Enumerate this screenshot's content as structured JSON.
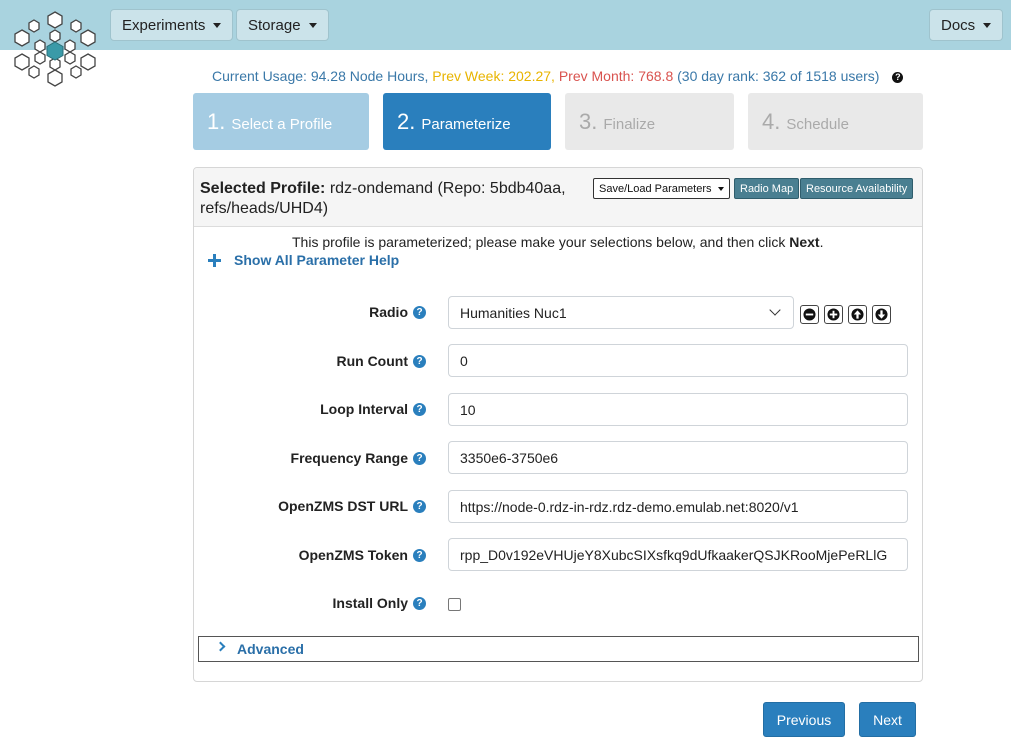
{
  "navbar": {
    "experiments_label": "Experiments",
    "storage_label": "Storage",
    "docs_label": "Docs",
    "logo_icon": "snowflake-logo-icon"
  },
  "usage": {
    "current": "Current Usage: 94.28 Node Hours,",
    "prev_week": "Prev Week: 202.27,",
    "prev_month": "Prev Month: 768.8",
    "rank": "(30 day rank: 362 of 1518 users)",
    "help": "?"
  },
  "steps": [
    {
      "num": "1.",
      "label": "Select a Profile"
    },
    {
      "num": "2.",
      "label": "Parameterize"
    },
    {
      "num": "3.",
      "label": "Finalize"
    },
    {
      "num": "4.",
      "label": "Schedule"
    }
  ],
  "panel": {
    "title_bold": "Selected Profile:",
    "title_rest": "rdz-ondemand (Repo: 5bdb40aa, refs/heads/UHD4)",
    "save_load_label": "Save/Load Parameters",
    "radio_map_label": "Radio Map",
    "resource_label": "Resource Availability",
    "intro_text": "This profile is parameterized; please make your selections below, and then click ",
    "intro_bold": "Next",
    "intro_end": ".",
    "show_help_label": "Show All Parameter Help",
    "advanced_label": "Advanced"
  },
  "form": {
    "radio_label": "Radio",
    "radio_value": "Humanities Nuc1",
    "run_count_label": "Run Count",
    "run_count_value": "0",
    "loop_interval_label": "Loop Interval",
    "loop_interval_value": "10",
    "freq_label": "Frequency Range",
    "freq_value": "3350e6-3750e6",
    "dst_url_label": "OpenZMS DST URL",
    "dst_url_value": "https://node-0.rdz-in-rdz.rdz-demo.emulab.net:8020/v1",
    "token_label": "OpenZMS Token",
    "token_value": "rpp_D0v192eVHUjeY8XubcSIXsfkq9dUfkaakerQSJKRooMjePeRLlG",
    "install_only_label": "Install Only",
    "install_only_checked": false,
    "help_glyph": "?"
  },
  "footer": {
    "previous_label": "Previous",
    "next_label": "Next"
  },
  "colors": {
    "navbar": "#a9d3df",
    "primary": "#2a7fbd",
    "step_done": "#a5cce3",
    "step_todo": "#e9e9e9",
    "warning": "#e8b400",
    "danger": "#d9534f"
  }
}
